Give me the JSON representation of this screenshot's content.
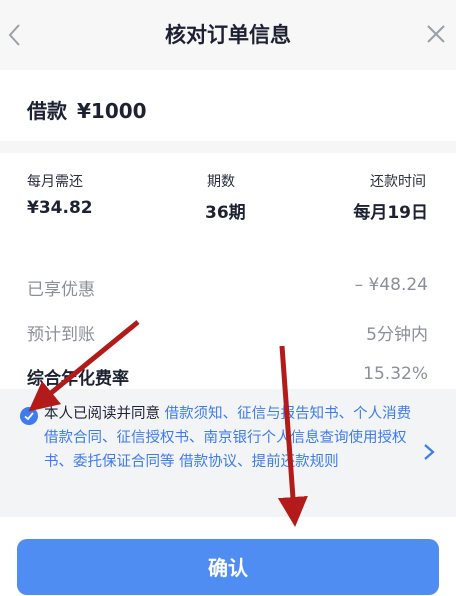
{
  "header": {
    "title": "核对订单信息"
  },
  "loan": {
    "label": "借款",
    "amount": "¥1000"
  },
  "summary": [
    {
      "label": "每月需还",
      "value": "¥34.82"
    },
    {
      "label": "期数",
      "value": "36期"
    },
    {
      "label": "还款时间",
      "value": "每月19日"
    }
  ],
  "details": [
    {
      "label": "已享优惠",
      "value": "– ¥48.24"
    },
    {
      "label": "预计到账",
      "value": "5分钟内"
    },
    {
      "label": "综合年化费率",
      "value": "15.32%"
    }
  ],
  "agreement": {
    "prefix": "本人已阅读并同意",
    "links": "借款须知、征信与报告知书、个人消费借款合同、征信授权书、南京银行个人信息查询使用授权书、委托保证合同等 借款协议、提前还款规则"
  },
  "confirm_label": "确认",
  "colors": {
    "accent": "#3d7bf0",
    "button": "#4f8df3",
    "arrow": "#b31b1b"
  },
  "icons": [
    "back-icon",
    "close-icon",
    "check-icon",
    "chevron-right-icon"
  ]
}
